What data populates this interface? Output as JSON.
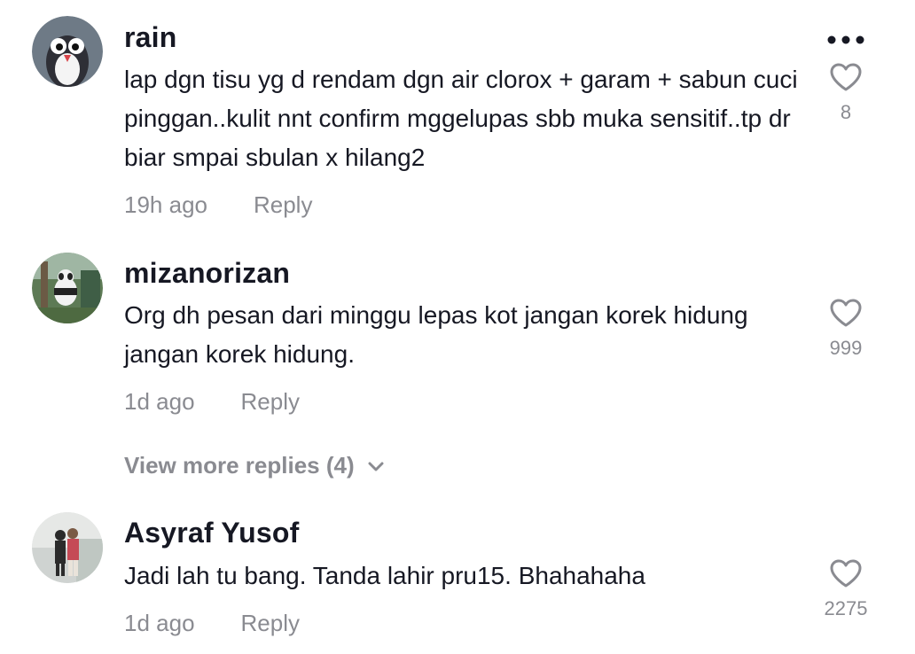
{
  "comments": [
    {
      "username": "rain",
      "text": "lap dgn tisu yg d rendam dgn air clorox + garam + sabun cuci pinggan..kulit nnt confirm mggelupas sbb muka sensitif..tp dr biar smpai sbulan x hilang2",
      "time": "19h ago",
      "reply_label": "Reply",
      "likes": "8",
      "avatar_icon": "penguin-avatar-icon"
    },
    {
      "username": "mizanorizan",
      "text": "Org dh pesan dari minggu lepas kot jangan korek hidung jangan korek hidung.",
      "time": "1d ago",
      "reply_label": "Reply",
      "likes": "999",
      "avatar_icon": "photo-avatar-icon"
    },
    {
      "username": "Asyraf Yusof",
      "text": "Jadi lah tu bang. Tanda lahir pru15. Bhahahaha",
      "time": "1d ago",
      "reply_label": "Reply",
      "likes": "2275",
      "avatar_icon": "photo-avatar-icon"
    }
  ],
  "view_more": {
    "label": "View more replies (4)",
    "icon": "chevron-down-icon"
  },
  "colors": {
    "primary_text": "#161823",
    "secondary_text": "#8a8b91",
    "icon": "#8a8b91"
  }
}
